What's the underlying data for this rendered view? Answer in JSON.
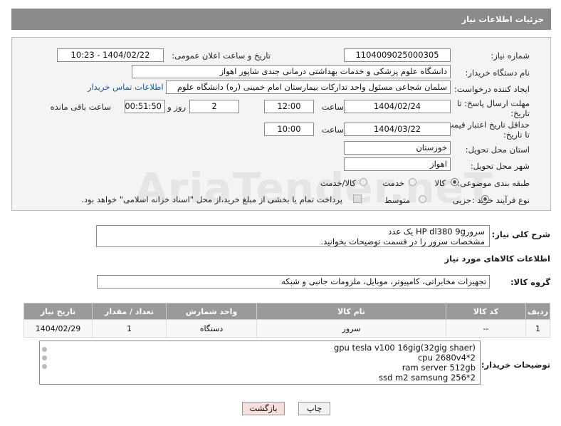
{
  "header": {
    "title": "جزئیات اطلاعات نیاز"
  },
  "form": {
    "need_number_label": "شماره نیاز:",
    "need_number": "1104009025000305",
    "announce_label": "تاریخ و ساعت اعلان عمومی:",
    "announce_value": "1404/02/22 - 10:23",
    "buyer_org_label": "نام دستگاه خریدار:",
    "buyer_org": "دانشگاه علوم پزشکی و خدمات بهداشتی درمانی جندی شاپور اهواز",
    "creator_label": "ایجاد کننده درخواست:",
    "creator": "سلمان شجاعی مسئول واحد تدارکات بیمارستان امام خمینی (ره) دانشگاه علوم",
    "contact_link": "اطلاعات تماس خریدار",
    "deadline_label_1": "مهلت ارسال پاسخ: تا",
    "deadline_label_2": "تاریخ:",
    "deadline_date": "1404/02/24",
    "time_label": "ساعت",
    "deadline_time": "12:00",
    "days_value": "2",
    "days_label": "روز و",
    "remaining_value": "00:51:50",
    "remaining_label": "ساعت باقی مانده",
    "min_price_label_1": "حداقل تاریخ اعتبار قیمت:",
    "min_price_label_2": "تا تاریخ:",
    "price_date": "1404/03/22",
    "price_time": "10:00",
    "province_label": "استان محل تحویل:",
    "province": "خوزستان",
    "city_label": "شهر محل تحویل:",
    "city": "اهواز",
    "category_label": "طبقه بندی موضوعی:",
    "cat_goods": "کالا",
    "cat_service": "خدمت",
    "cat_goods_service": "کالا/خدمت",
    "process_label": "نوع فرآیند خرید :",
    "proc_partial": "جزیی",
    "proc_medium": "متوسط",
    "payment_note": "پرداخت تمام یا بخشی از مبلغ خرید،از محل \"اسناد خزانه اسلامی\" خواهد بود."
  },
  "summary": {
    "label": "شرح کلی نیاز:",
    "line1": "سرورHP dl380 9g     یک عدد",
    "line2": "مشخصات سرور را در قسمت توضیحات بخوانید."
  },
  "goods": {
    "section_title": "اطلاعات کالاهای مورد نیاز",
    "group_label": "گروه کالا:",
    "group_value": "تجهیزات مخابراتی، کامپیوتر، موبایل، ملزومات جانبی و شبکه"
  },
  "table": {
    "headers": [
      "ردیف",
      "کد کالا",
      "نام کالا",
      "واحد شمارش",
      "تعداد / مقدار",
      "تاریخ نیاز"
    ],
    "rows": [
      [
        "1",
        "--",
        "سرور",
        "دستگاه",
        "1",
        "1404/02/29"
      ]
    ]
  },
  "buyer_notes": {
    "label": "توضیحات خریدار:",
    "lines": [
      "gpu tesla v100 16gig(32gig shaer)",
      "cpu 2680v4*2",
      "ram server 512gb",
      "ssd m2 samsung 256*2"
    ]
  },
  "buttons": {
    "print": "چاپ",
    "back": "بازگشت"
  },
  "watermark": "AriaTender.neT"
}
